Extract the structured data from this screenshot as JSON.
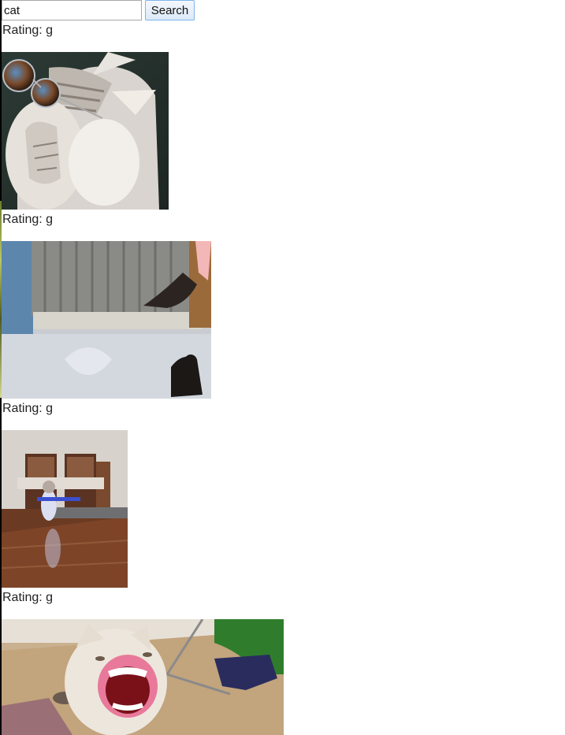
{
  "search": {
    "query": "cat",
    "button_label": "Search"
  },
  "results": [
    {
      "rating": "Rating: g",
      "thumbnail": "cat-with-sunglasses"
    },
    {
      "rating": "Rating: g",
      "thumbnail": "kitten-jumping-near-door"
    },
    {
      "rating": "Rating: g",
      "thumbnail": "cat-playing-guitar-toy"
    },
    {
      "rating": "Rating: g",
      "thumbnail": "cat-with-human-lips"
    }
  ],
  "colors": {
    "button_border": "#7eb4ea",
    "input_border": "#a9a9a9"
  }
}
